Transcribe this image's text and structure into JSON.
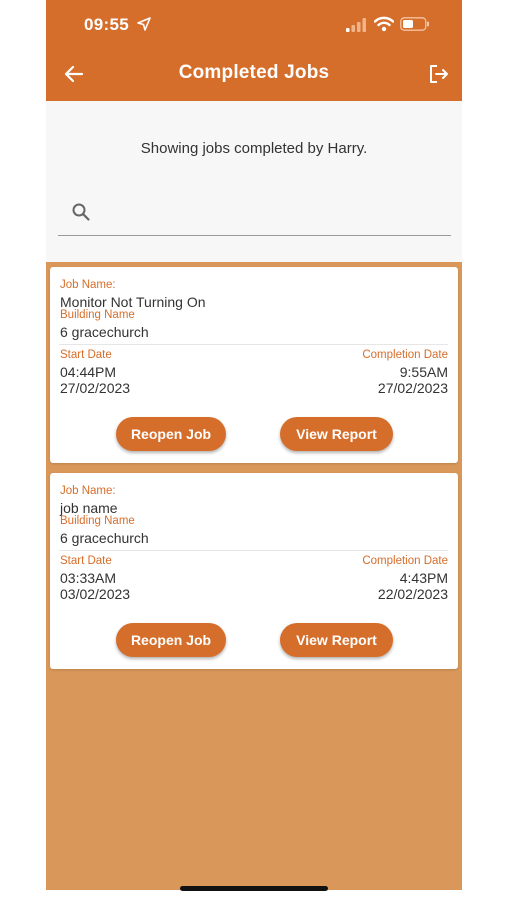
{
  "status_bar": {
    "time": "09:55"
  },
  "header": {
    "title": "Completed Jobs"
  },
  "subtitle": "Showing jobs completed by Harry.",
  "search": {
    "value": "",
    "placeholder": ""
  },
  "labels": {
    "job_name": "Job Name:",
    "building_name": "Building Name",
    "start_date": "Start Date",
    "completion_date": "Completion Date"
  },
  "buttons": {
    "reopen": "Reopen Job",
    "view_report": "View Report"
  },
  "jobs": [
    {
      "job_name": "Monitor Not Turning On",
      "building_name": "6 gracechurch",
      "start_time": "04:44PM",
      "start_date": "27/02/2023",
      "completion_time": "9:55AM",
      "completion_date": "27/02/2023"
    },
    {
      "job_name": "job name",
      "building_name": "6 gracechurch",
      "start_time": "03:33AM",
      "start_date": "03/02/2023",
      "completion_time": "4:43PM",
      "completion_date": "22/02/2023"
    }
  ],
  "colors": {
    "accent": "#d56e2b",
    "list_background": "#d9975a"
  }
}
